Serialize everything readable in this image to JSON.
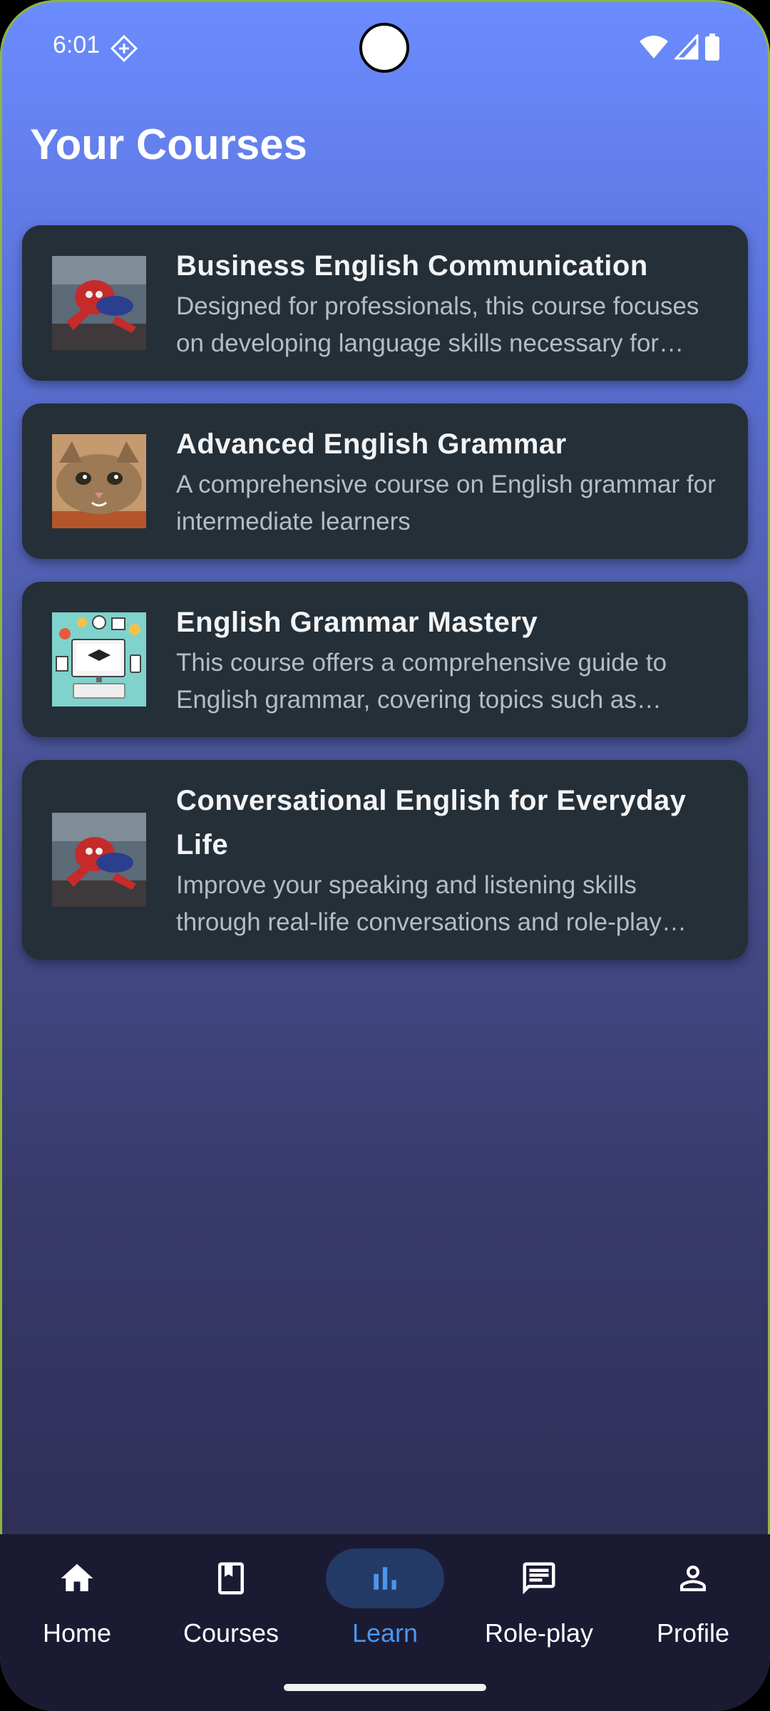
{
  "status_bar": {
    "time": "6:01"
  },
  "page": {
    "title": "Your Courses"
  },
  "courses": [
    {
      "title": "Business English Communication",
      "description": " Designed for professionals, this course focuses on developing language skills necessary for effective business communication",
      "thumbnail": "spider-hero-image"
    },
    {
      "title": "Advanced English Grammar",
      "description": "A comprehensive course on English grammar for intermediate learners",
      "thumbnail": "cat-image"
    },
    {
      "title": "English Grammar Mastery",
      "description": "This course offers a comprehensive guide to English grammar, covering topics such as tenses, articles and prepositions",
      "thumbnail": "education-illustration-image"
    },
    {
      "title": "Conversational English for Everyday Life",
      "description": "Improve your speaking and listening skills through real-life conversations and role-play exercises",
      "thumbnail": "spider-hero-image"
    }
  ],
  "bottom_nav": {
    "items": [
      {
        "label": "Home",
        "icon": "home-icon"
      },
      {
        "label": "Courses",
        "icon": "book-icon"
      },
      {
        "label": "Learn",
        "icon": "bar-chart-icon",
        "active": true
      },
      {
        "label": "Role-play",
        "icon": "chat-icon"
      },
      {
        "label": "Profile",
        "icon": "person-icon"
      }
    ]
  },
  "colors": {
    "card_background": "#252f37",
    "nav_background": "#1b1a33",
    "active_accent": "#4d95ec",
    "active_pill": "#243a66"
  }
}
